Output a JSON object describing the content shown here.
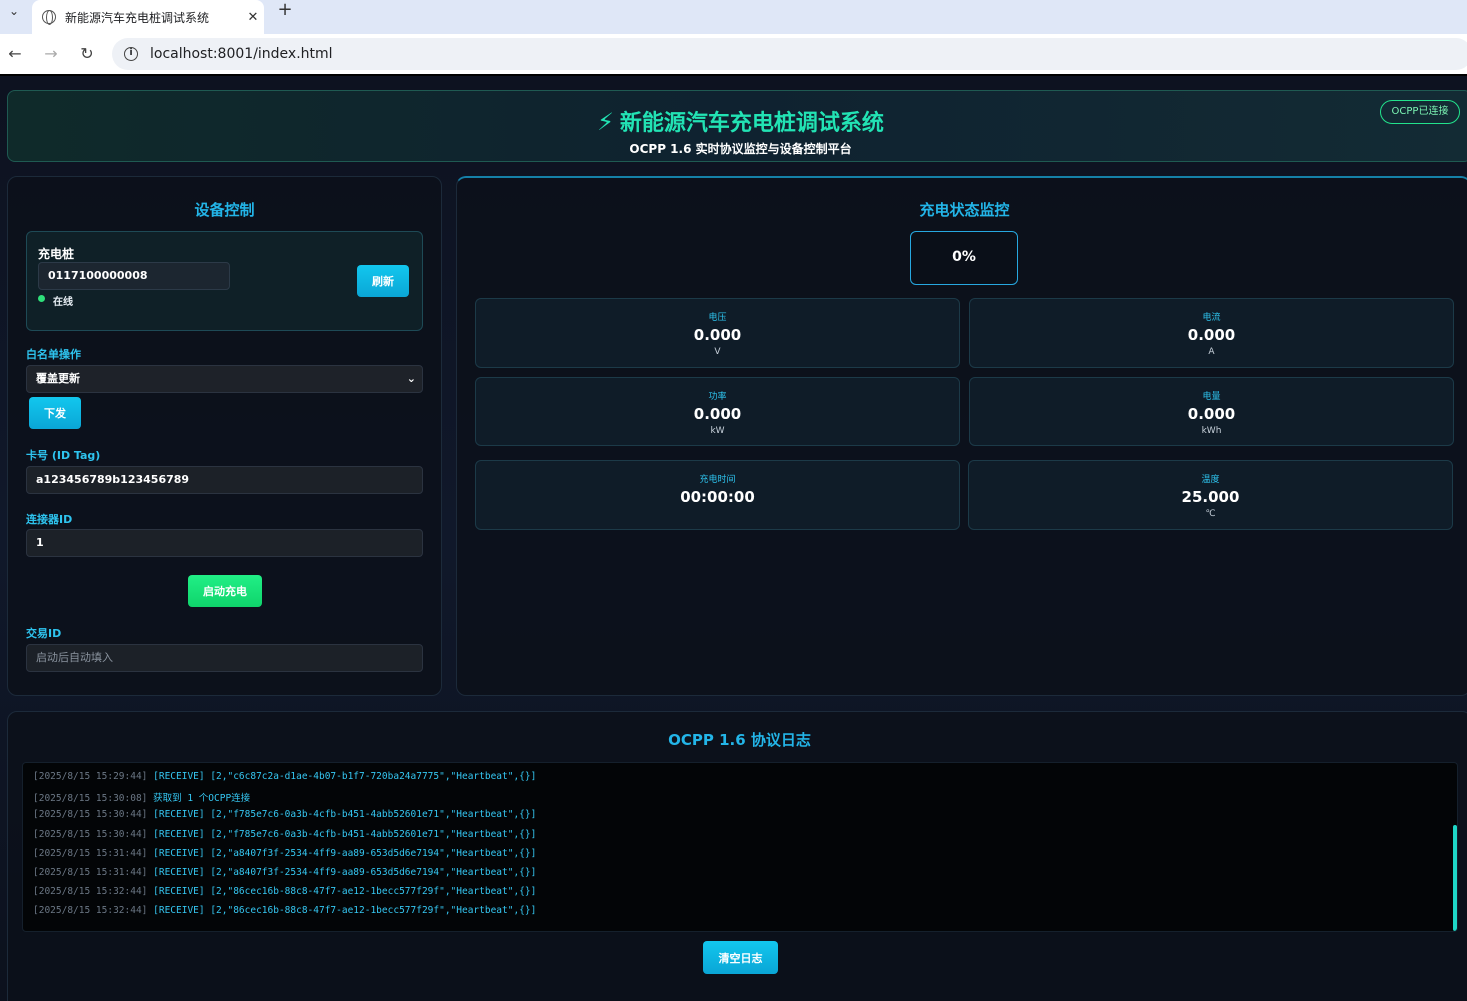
{
  "browser": {
    "tab_title": "新能源汽车充电桩调试系统",
    "url": "localhost:8001/index.html"
  },
  "header": {
    "title": "新能源汽车充电桩调试系统",
    "subtitle": "OCPP 1.6 实时协议监控与设备控制平台",
    "connection_badge": "OCPP已连接"
  },
  "device_control": {
    "title": "设备控制",
    "pile_label": "充电桩",
    "pile_id": "0117100000008",
    "refresh_label": "刷新",
    "status_text": "在线",
    "whitelist_label": "白名单操作",
    "whitelist_selected": "覆盖更新",
    "send_label": "下发",
    "id_tag_label": "卡号 (ID Tag)",
    "id_tag_value": "a123456789b123456789",
    "connector_label": "连接器ID",
    "connector_value": "1",
    "start_label": "启动充电",
    "transaction_label": "交易ID",
    "transaction_placeholder": "启动后自动填入"
  },
  "monitor": {
    "title": "充电状态监控",
    "progress_text": "0%",
    "progress": 0,
    "metrics": [
      {
        "label": "电压",
        "value": "0.000",
        "unit": "V"
      },
      {
        "label": "电流",
        "value": "0.000",
        "unit": "A"
      },
      {
        "label": "功率",
        "value": "0.000",
        "unit": "kW"
      },
      {
        "label": "电量",
        "value": "0.000",
        "unit": "kWh"
      },
      {
        "label": "充电时间",
        "value": "00:00:00",
        "unit": ""
      },
      {
        "label": "温度",
        "value": "25.000",
        "unit": "℃"
      }
    ]
  },
  "log": {
    "title": "OCPP 1.6 协议日志",
    "clear_label": "清空日志",
    "entries": [
      {
        "time": "[2025/8/15 15:29:44]",
        "msg": "[RECEIVE] [2,\"c6c87c2a-d1ae-4b07-b1f7-720ba24a7775\",\"Heartbeat\",{}]"
      },
      {
        "time": "[2025/8/15 15:30:08]",
        "msg": "获取到 1 个OCPP连接"
      },
      {
        "time": "[2025/8/15 15:30:44]",
        "msg": "[RECEIVE] [2,\"f785e7c6-0a3b-4cfb-b451-4abb52601e71\",\"Heartbeat\",{}]"
      },
      {
        "time": "[2025/8/15 15:30:44]",
        "msg": "[RECEIVE] [2,\"f785e7c6-0a3b-4cfb-b451-4abb52601e71\",\"Heartbeat\",{}]"
      },
      {
        "time": "[2025/8/15 15:31:44]",
        "msg": "[RECEIVE] [2,\"a8407f3f-2534-4ff9-aa89-653d5d6e7194\",\"Heartbeat\",{}]"
      },
      {
        "time": "[2025/8/15 15:31:44]",
        "msg": "[RECEIVE] [2,\"a8407f3f-2534-4ff9-aa89-653d5d6e7194\",\"Heartbeat\",{}]"
      },
      {
        "time": "[2025/8/15 15:32:44]",
        "msg": "[RECEIVE] [2,\"86cec16b-88c8-47f7-ae12-1becc577f29f\",\"Heartbeat\",{}]"
      },
      {
        "time": "[2025/8/15 15:32:44]",
        "msg": "[RECEIVE] [2,\"86cec16b-88c8-47f7-ae12-1becc577f29f\",\"Heartbeat\",{}]"
      }
    ]
  }
}
